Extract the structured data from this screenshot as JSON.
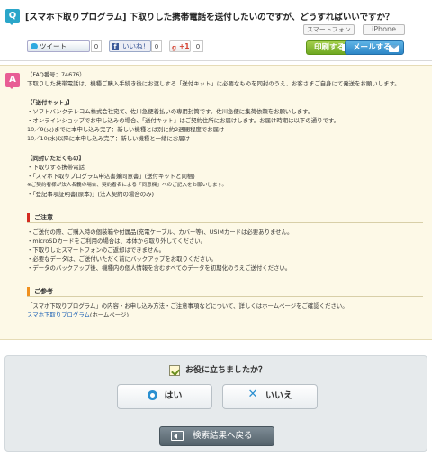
{
  "question": {
    "badge": "Q",
    "title": "[スマホ下取りプログラム] 下取りした携帯電話を送付したいのですが、どうすればいいですか？",
    "tags": [
      "スマートフォン",
      "iPhone"
    ]
  },
  "share": {
    "tweet_label": "ツイート",
    "tweet_count": "0",
    "like_label": "いいね！",
    "like_count": "0",
    "gplus_label": "+1",
    "gplus_count": "0"
  },
  "actions": {
    "print_label": "印刷する",
    "mail_label": "メールする"
  },
  "answer": {
    "badge": "A",
    "faq_no": "（FAQ番号：74676）",
    "intro": "下取りした携帯電話は、機種ご購入手続き後にお渡しする「送付キット」に必要なものを同封のうえ、お客さまご自身にて発送をお願いします。",
    "kit_title": "【「送付キット」】",
    "kit_lines": [
      "・ソフトバンクテレコム株式会社宛て、佐川急便着払いの専用封筒です。佐川急便に集荷依頼をお願いします。",
      "・オンラインショップでお申し込みの場合、「送付キット」はご契約住所にお届けします。お届け時期は以下の通りです。",
      "10／9(火)までに本申し込み完了：新しい機種とは別に約2週間程度でお届け",
      "10／10(水)以降に本申し込み完了：新しい機種と一緒にお届け"
    ],
    "enclose_title": "【同封いただくもの】",
    "enclose_lines": [
      "・下取りする携帯電話",
      "・「スマホ下取りプログラム申込書兼同意書」(送付キットと同梱)",
      "※ご契約者様が法人名義の場合、契約者名による「同意欄」へのご記入をお願いします。",
      "・「登記事項証明書(原本)」(法人契約の場合のみ)"
    ],
    "caution_title": "ご注意",
    "caution_lines": [
      "・ご送付の際、ご購入時の個装箱や付属品(充電ケーブル、カバー等)、USIMカードは必要ありません。",
      "・microSDカードをご利用の場合は、本体から取り外してください。",
      "・下取りしたスマートフォンのご返却はできません。",
      "・必要なデータは、ご送付いただく前にバックアップをお取りください。",
      "・データのバックアップ後、機種内の個人情報を含むすべてのデータを初期化のうえご送付ください。"
    ],
    "ref_title": "ご参考",
    "ref_line": "「スマホ下取りプログラム」の内容・お申し込み方法・ご注意事項などについて、詳しくはホームページをご確認ください。",
    "ref_link": "スマホ下取りプログラム",
    "ref_link_suffix": "(ホームページ)"
  },
  "feedback": {
    "question": "お役に立ちましたか？",
    "yes_label": "はい",
    "no_label": "いいえ",
    "back_label": "検索結果へ戻る"
  },
  "colors": {
    "q_badge": "#2aa6c9",
    "a_badge": "#e85e95",
    "caution_bar": "#d42b20",
    "ref_bar": "#f0901e",
    "link": "#1a5fb4"
  }
}
